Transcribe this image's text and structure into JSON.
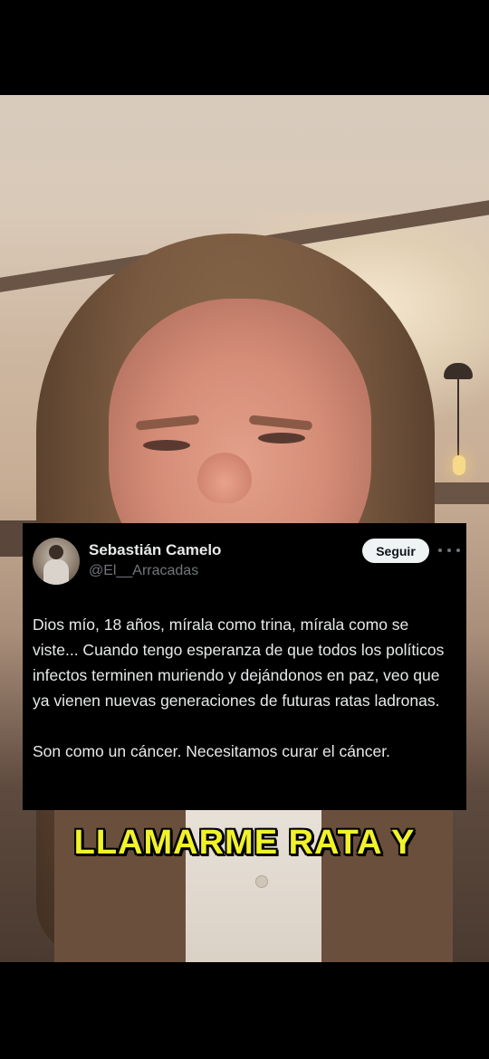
{
  "tweet": {
    "display_name": "Sebastián Camelo",
    "handle": "@El__Arracadas",
    "follow_label": "Seguir",
    "paragraphs": [
      "Dios mío, 18 años, mírala como trina, mírala como se viste... Cuando tengo esperanza de que todos los políticos infectos terminen muriendo y dejándonos en paz, veo que ya vienen nuevas generaciones de futuras ratas ladronas.",
      "Son como un cáncer. Necesitamos curar el cáncer."
    ]
  },
  "caption": "LLAMARME RATA Y",
  "colors": {
    "caption": "#f1f22a",
    "card_background": "#000000",
    "follow_button": "#eff3f4",
    "handle": "#71767b"
  },
  "icons": {
    "more": "more-horizontal-icon",
    "avatar": "user-avatar"
  }
}
